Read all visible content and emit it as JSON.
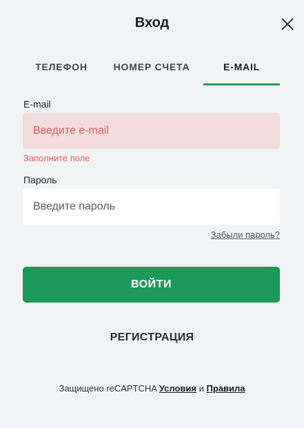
{
  "modal": {
    "title": "Вход",
    "close_icon": "close-icon"
  },
  "tabs": [
    {
      "label": "ТЕЛЕФОН",
      "active": false
    },
    {
      "label": "НОМЕР СЧЕТА",
      "active": false
    },
    {
      "label": "E-MAIL",
      "active": true
    }
  ],
  "form": {
    "email_label": "E-mail",
    "email_placeholder": "Введите e-mail",
    "email_error": "Заполните поле",
    "password_label": "Пароль",
    "password_placeholder": "Введите пароль",
    "forgot_link": "Забыли пароль?",
    "submit_label": "ВОЙТИ",
    "register_label": "РЕГИСТРАЦИЯ"
  },
  "footer": {
    "protected_text": "Защищено reCAPTCHA",
    "terms_link": "Условия",
    "and_text": "и",
    "rules_link": "Правила"
  },
  "colors": {
    "accent": "#1c9b58",
    "error": "#e45a5f",
    "error_bg": "#f3dcdd",
    "background": "#f2f3f5"
  }
}
